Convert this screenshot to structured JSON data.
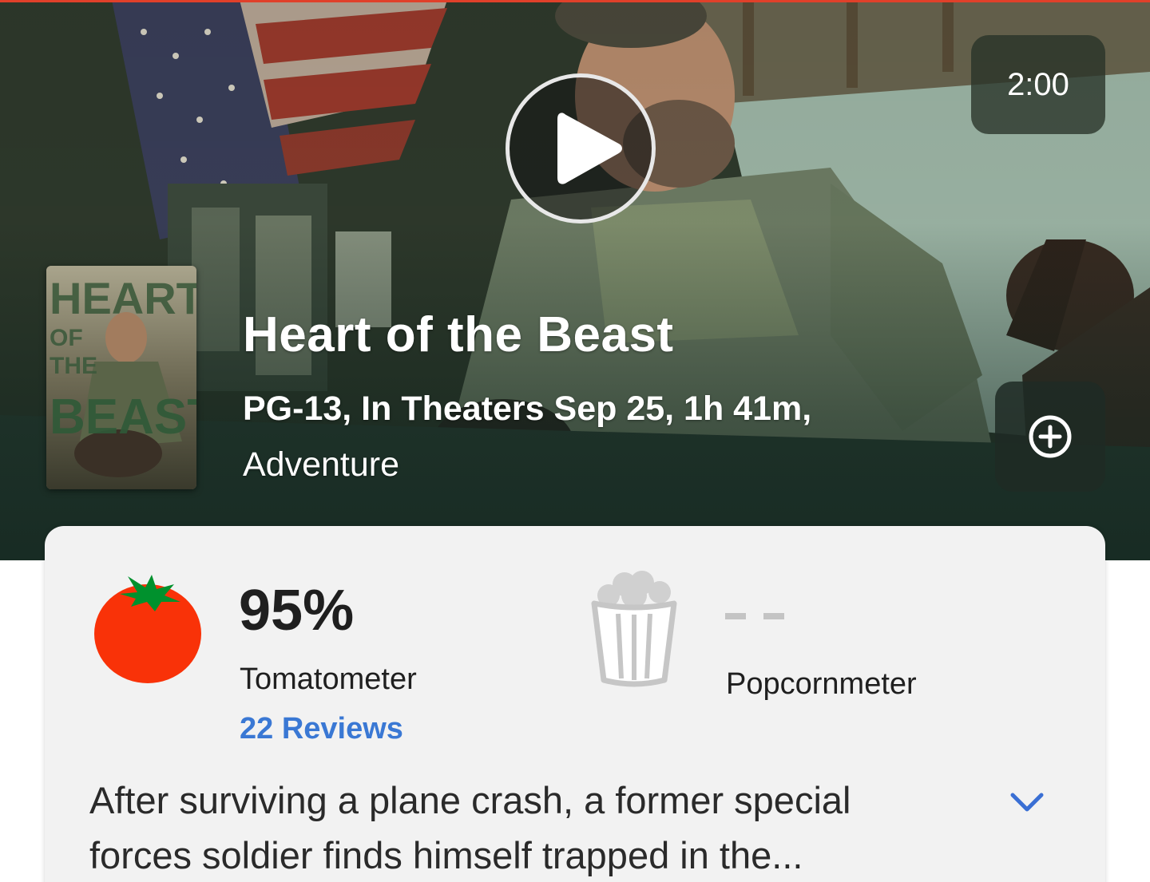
{
  "hero": {
    "duration": "2:00",
    "play_icon": "play-icon",
    "add_icon": "add-circle-icon"
  },
  "movie": {
    "title": "Heart of the Beast",
    "meta": "PG-13, In Theaters Sep 25, 1h 41m,",
    "genre": "Adventure",
    "poster_text": [
      "HEART",
      "OF",
      "THE",
      "BEAST"
    ]
  },
  "scores": {
    "tomatometer": {
      "value": "95%",
      "label": "Tomatometer",
      "reviews": "22 Reviews",
      "icon": "tomato-icon"
    },
    "popcornmeter": {
      "value": "- -",
      "label": "Popcornmeter",
      "icon": "popcorn-bucket-icon"
    }
  },
  "synopsis": {
    "line1": "After surviving a plane crash, a former special",
    "line2": "forces soldier finds himself trapped in the...",
    "expand_icon": "chevron-down-icon"
  },
  "colors": {
    "accent_line": "#e0402a",
    "tomato_red": "#f93208",
    "link_blue": "#3a78d4",
    "card_bg": "#f2f2f2"
  }
}
